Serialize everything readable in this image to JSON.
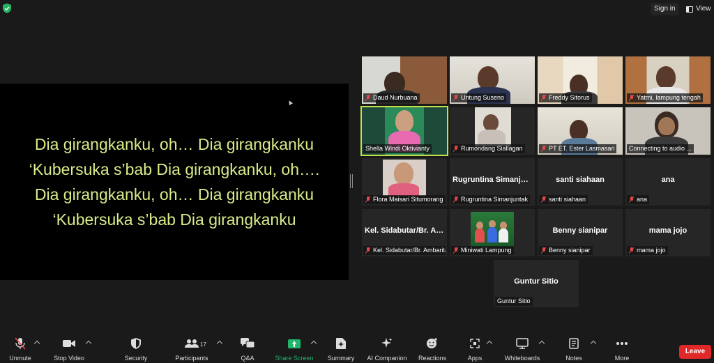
{
  "topbar": {
    "sign_in": "Sign in",
    "view": "View"
  },
  "shared_screen": {
    "lines": [
      "Dia girangkanku, oh… Dia girangkanku",
      "‘Kubersuka s’bab Dia girangkanku, oh….",
      "Dia girangkanku, oh… Dia girangkanku",
      "‘Kubersuka s’bab Dia girangkanku"
    ]
  },
  "participants": [
    {
      "label": "Daud Nurbuana"
    },
    {
      "label": "Untung Suseno"
    },
    {
      "label": "Freddy Sitorus"
    },
    {
      "label": "Yatmi, lampung tengah"
    },
    {
      "label": "Shella Windi Oktivianty"
    },
    {
      "label": "Rumondang Siallagan"
    },
    {
      "label": "PT ET. Ester Lasmasari"
    },
    {
      "label": "Connecting to audio ..."
    },
    {
      "label": "Flora Maisari Situmorang"
    },
    {
      "big": "Rugruntina  Simanjuntak",
      "label": "Rugruntina Simanjuntak"
    },
    {
      "big": "santi siahaan",
      "label": "santi siahaan"
    },
    {
      "big": "ana",
      "label": "ana"
    },
    {
      "big": "Kel.  Sidabutar/Br. Ambarita",
      "label": "Kel. Sidabutar/Br. Ambarita"
    },
    {
      "label": "Miniwati Lampung"
    },
    {
      "big": "Benny sianipar",
      "label": "Benny sianipar"
    },
    {
      "big": "mama jojo",
      "label": "mama jojo"
    },
    {
      "big": "Guntur Sitio",
      "label": "Guntur Sitio"
    }
  ],
  "toolbar": {
    "unmute": "Unmute",
    "stop_video": "Stop Video",
    "security": "Security",
    "participants": "Participants",
    "participants_count": "17",
    "qa": "Q&A",
    "share_screen": "Share Screen",
    "summary": "Summary",
    "ai_companion": "AI Companion",
    "reactions": "Reactions",
    "apps": "Apps",
    "whiteboards": "Whiteboards",
    "notes": "Notes",
    "more": "More",
    "leave": "Leave"
  },
  "colors": {
    "accent": "#c6e04a",
    "share_green": "#1fb66b",
    "leave_red": "#e02828",
    "lyric": "#d8ec8a"
  }
}
